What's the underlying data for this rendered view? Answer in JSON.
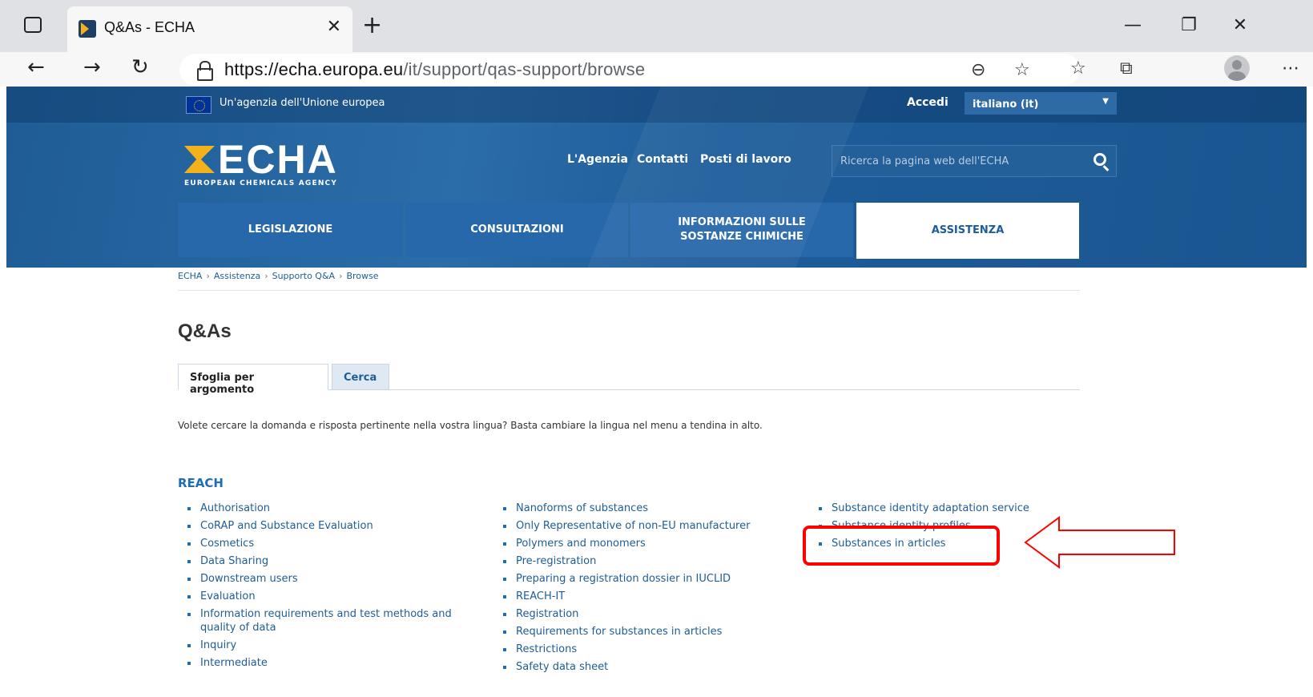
{
  "browser": {
    "tab_title": "Q&As - ECHA",
    "url_host": "https://echa.europa.eu",
    "url_path": "/it/support/qas-support/browse"
  },
  "header": {
    "eu_agency_text": "Un'agenzia dell'Unione europea",
    "login_label": "Accedi",
    "language": "italiano (it)",
    "logo_text": "ECHA",
    "logo_subtitle": "EUROPEAN CHEMICALS AGENCY",
    "nav": [
      "L'Agenzia",
      "Contatti",
      "Posti di lavoro"
    ],
    "search_placeholder": "Ricerca la pagina web dell'ECHA",
    "main_nav": [
      "LEGISLAZIONE",
      "CONSULTAZIONI",
      "INFORMAZIONI SULLE SOSTANZE CHIMICHE",
      "ASSISTENZA"
    ]
  },
  "breadcrumb": [
    "ECHA",
    "Assistenza",
    "Supporto Q&A",
    "Browse"
  ],
  "page_title": "Q&As",
  "tabs": [
    "Sfoglia per argomento",
    "Cerca"
  ],
  "intro": "Volete cercare la domanda e risposta pertinente nella vostra lingua? Basta cambiare la lingua nel menu a tendina in alto.",
  "section": "REACH",
  "columns": {
    "col1": [
      "Authorisation",
      "CoRAP and Substance Evaluation",
      "Cosmetics",
      "Data Sharing",
      "Downstream users",
      "Evaluation",
      "Information requirements and test methods and quality of data",
      "Inquiry",
      "Intermediate"
    ],
    "col2": [
      "Nanoforms of substances",
      "Only Representative of non-EU manufacturer",
      "Polymers and monomers",
      "Pre-registration",
      "Preparing a registration dossier in IUCLID",
      "REACH-IT",
      "Registration",
      "Requirements for substances in articles",
      "Restrictions",
      "Safety data sheet"
    ],
    "col3": [
      "Substance identity adaptation service",
      "Substance identity profiles",
      "Substances in articles"
    ]
  },
  "colors": {
    "brand": "#1d5c9a",
    "accent": "#f3b21c",
    "link": "#1f5c96",
    "annotation": "#ff0000"
  }
}
